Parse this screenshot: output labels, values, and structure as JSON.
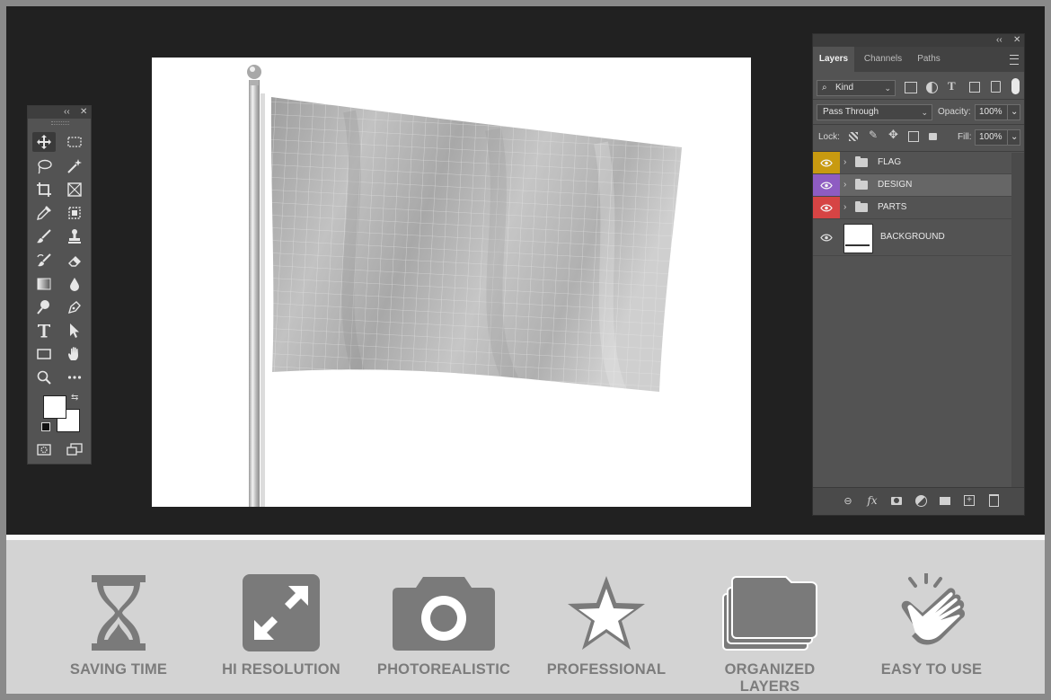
{
  "layers_panel": {
    "tabs": [
      {
        "label": "Layers",
        "active": true
      },
      {
        "label": "Channels",
        "active": false
      },
      {
        "label": "Paths",
        "active": false
      }
    ],
    "filter": {
      "value": "Kind"
    },
    "blend_mode": {
      "value": "Pass Through"
    },
    "opacity": {
      "label": "Opacity:",
      "value": "100%"
    },
    "lock": {
      "label": "Lock:"
    },
    "fill": {
      "label": "Fill:",
      "value": "100%"
    },
    "layers": [
      {
        "name": "FLAG",
        "color": "#c89a10",
        "type": "group",
        "selected": false
      },
      {
        "name": "DESIGN",
        "color": "#8e5cc2",
        "type": "group",
        "selected": true
      },
      {
        "name": "PARTS",
        "color": "#d64444",
        "type": "group",
        "selected": false
      },
      {
        "name": "BACKGROUND",
        "color": "",
        "type": "image",
        "selected": false
      }
    ],
    "footer_icons": [
      "link-icon",
      "fx-icon",
      "mask-icon",
      "adjustment-icon",
      "folder-icon",
      "new-layer-icon",
      "trash-icon"
    ]
  },
  "tools_panel": {
    "tools": [
      "move-tool",
      "marquee-tool",
      "lasso-tool",
      "magic-wand-tool",
      "crop-tool",
      "frame-tool",
      "eyedropper-tool",
      "patch-tool",
      "brush-tool",
      "stamp-tool",
      "history-brush-tool",
      "eraser-tool",
      "gradient-tool",
      "blur-tool",
      "dodge-tool",
      "pen-tool",
      "type-tool",
      "path-select-tool",
      "rectangle-tool",
      "hand-tool",
      "zoom-tool",
      "more-tools"
    ],
    "foreground_color": "#ffffff",
    "background_color": "#ffffff"
  },
  "features": [
    {
      "label": "SAVING TIME",
      "icon": "hourglass-icon"
    },
    {
      "label": "HI RESOLUTION",
      "icon": "expand-icon"
    },
    {
      "label": "PHOTOREALISTIC",
      "icon": "camera-icon"
    },
    {
      "label": "PROFESSIONAL",
      "icon": "star-icon"
    },
    {
      "label": "ORGANIZED LAYERS",
      "icon": "folders-icon"
    },
    {
      "label": "EASY TO USE",
      "icon": "pointer-hand-icon"
    }
  ]
}
